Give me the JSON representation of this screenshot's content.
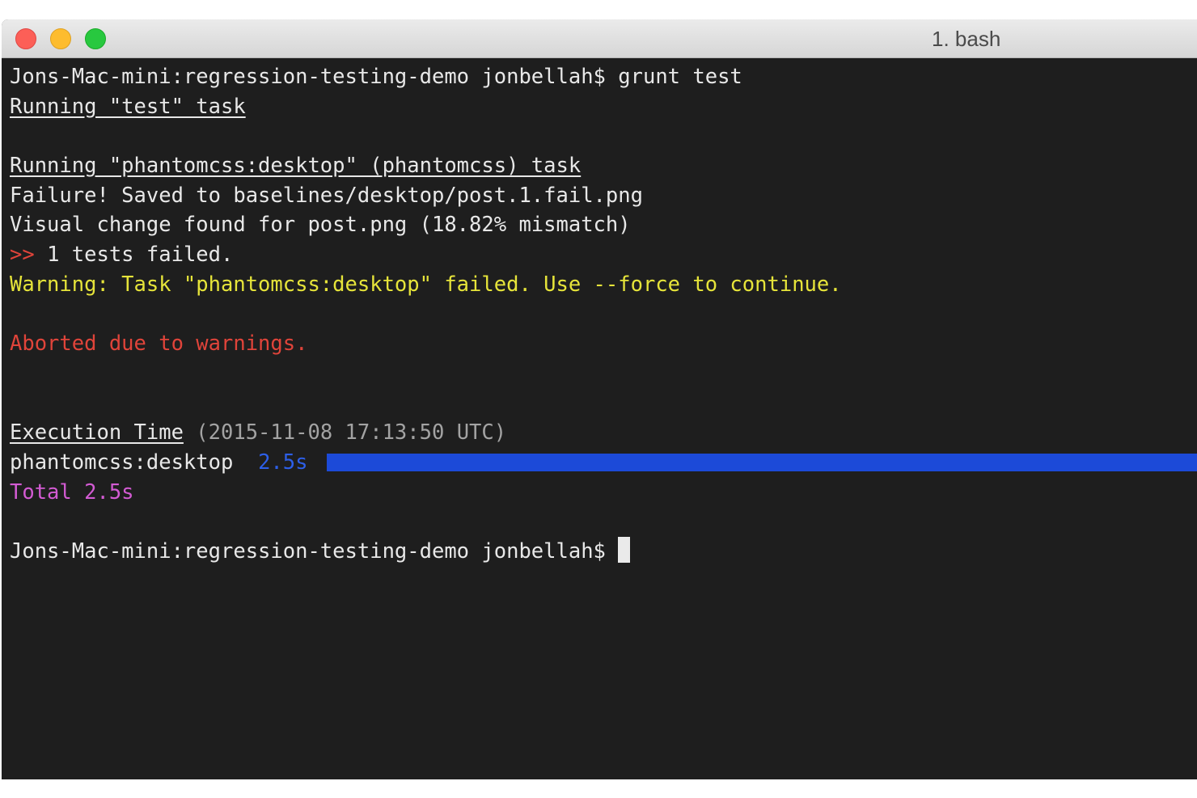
{
  "window": {
    "title": "1. bash",
    "traffic_lights": {
      "close": "#fc5f57",
      "minimize": "#fdbc2e",
      "zoom": "#28c83f"
    }
  },
  "terminal": {
    "prompt_command": "Jons-Mac-mini:regression-testing-demo jonbellah$ grunt test",
    "task_header": "Running \"test\" task",
    "subtask_header": "Running \"phantomcss:desktop\" (phantomcss) task",
    "failure_line": "Failure! Saved to baselines/desktop/post.1.fail.png",
    "visual_change_line": "Visual change found for post.png (18.82% mismatch)",
    "tests_failed_marker": ">>",
    "tests_failed_text": " 1 tests failed.",
    "warning_line": "Warning: Task \"phantomcss:desktop\" failed. Use --force to continue.",
    "aborted_line": "Aborted due to warnings.",
    "execution_time_label": "Execution Time",
    "execution_time_stamp": " (2015-11-08 17:13:50 UTC)",
    "timing_task_name": "phantomcss:desktop",
    "timing_task_value": "2.5s",
    "timing_bar_fraction": 1.0,
    "total_line": "Total 2.5s",
    "final_prompt": "Jons-Mac-mini:regression-testing-demo jonbellah$ "
  },
  "colors": {
    "background": "#1e1e1e",
    "text": "#e8e8e8",
    "error_red": "#e0443a",
    "warning_yellow": "#e6e43a",
    "timestamp_gray": "#a3a3a3",
    "timing_blue": "#2d5fe8",
    "bar_blue": "#1c4ad8",
    "total_magenta": "#d35bd3"
  }
}
